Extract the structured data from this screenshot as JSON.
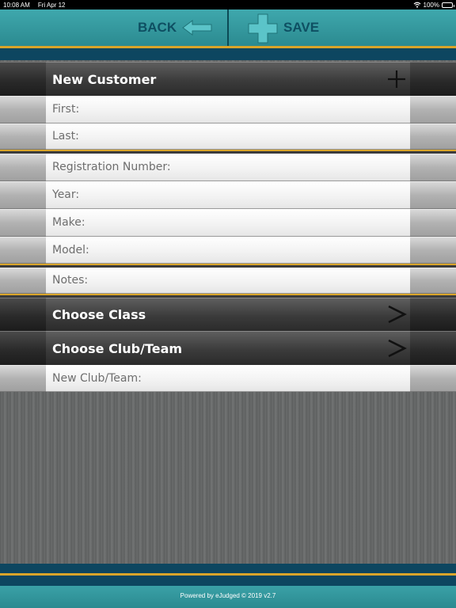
{
  "status_bar": {
    "time": "10:08 AM",
    "date": "Fri Apr 12",
    "battery": "100%",
    "wifi_icon": "wifi-icon"
  },
  "toolbar": {
    "back_label": "BACK",
    "save_label": "SAVE",
    "back_icon": "arrow-left-icon",
    "save_icon": "plus-icon"
  },
  "form": {
    "header": {
      "label": "New Customer",
      "icon": "plus-icon"
    },
    "fields": [
      {
        "key": "first",
        "placeholder": "First:",
        "value": ""
      },
      {
        "key": "last",
        "placeholder": "Last:",
        "value": ""
      },
      {
        "key": "registration",
        "placeholder": "Registration Number:",
        "value": ""
      },
      {
        "key": "year",
        "placeholder": "Year:",
        "value": ""
      },
      {
        "key": "make",
        "placeholder": "Make:",
        "value": ""
      },
      {
        "key": "model",
        "placeholder": "Model:",
        "value": ""
      },
      {
        "key": "notes",
        "placeholder": "Notes:",
        "value": ""
      }
    ],
    "choose_class": {
      "label": "Choose Class",
      "icon": "chevron-right-icon"
    },
    "choose_club": {
      "label": "Choose Club/Team",
      "icon": "chevron-right-icon"
    },
    "new_club": {
      "placeholder": "New Club/Team:",
      "value": ""
    }
  },
  "footer": {
    "text": "Powered by eJudged © 2019 v2.7"
  },
  "colors": {
    "teal": "#2f979d",
    "navy": "#0d4660",
    "gold": "#d9a52a",
    "toolbar_text": "#0e4f62"
  }
}
